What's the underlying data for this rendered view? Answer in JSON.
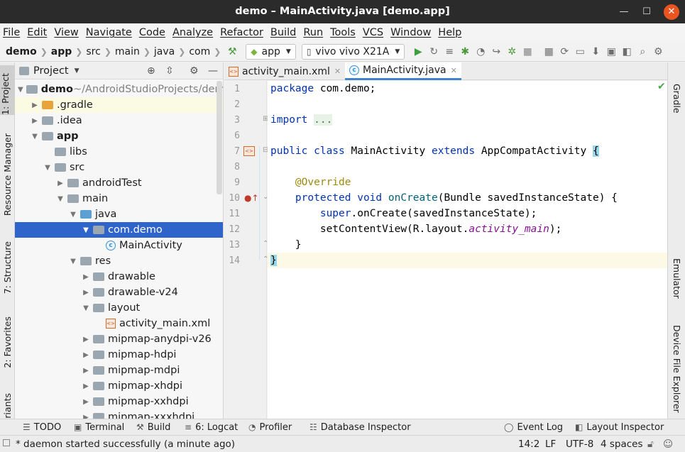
{
  "window": {
    "title": "demo – MainActivity.java [demo.app]"
  },
  "menu": [
    "File",
    "Edit",
    "View",
    "Navigate",
    "Code",
    "Analyze",
    "Refactor",
    "Build",
    "Run",
    "Tools",
    "VCS",
    "Window",
    "Help"
  ],
  "toolbar": {
    "breadcrumbs": [
      "demo",
      "app",
      "src",
      "main",
      "java",
      "com"
    ],
    "run_config": "app",
    "device": "vivo vivo X21A"
  },
  "left_strip": [
    "1: Project",
    "Resource Manager",
    "7: Structure",
    "2: Favorites",
    "riants"
  ],
  "right_strip": [
    "Gradle",
    "Emulator",
    "Device File Explorer"
  ],
  "project_panel": {
    "title": "Project",
    "tree": [
      {
        "label": "demo",
        "suffix": " ~/AndroidStudioProjects/dem",
        "depth": 0,
        "arrow": "down",
        "icon": "folder-module"
      },
      {
        "label": ".gradle",
        "depth": 1,
        "arrow": "right",
        "icon": "folder-orange"
      },
      {
        "label": ".idea",
        "depth": 1,
        "arrow": "right",
        "icon": "folder"
      },
      {
        "label": "app",
        "depth": 1,
        "arrow": "down",
        "icon": "folder-module"
      },
      {
        "label": "libs",
        "depth": 2,
        "arrow": "",
        "icon": "folder"
      },
      {
        "label": "src",
        "depth": 2,
        "arrow": "down",
        "icon": "folder"
      },
      {
        "label": "androidTest",
        "depth": 3,
        "arrow": "right",
        "icon": "folder"
      },
      {
        "label": "main",
        "depth": 3,
        "arrow": "down",
        "icon": "folder"
      },
      {
        "label": "java",
        "depth": 4,
        "arrow": "down",
        "icon": "folder-blue"
      },
      {
        "label": "com.demo",
        "depth": 5,
        "arrow": "down",
        "icon": "folder"
      },
      {
        "label": "MainActivity",
        "depth": 6,
        "arrow": "",
        "icon": "class"
      },
      {
        "label": "res",
        "depth": 4,
        "arrow": "down",
        "icon": "folder"
      },
      {
        "label": "drawable",
        "depth": 5,
        "arrow": "right",
        "icon": "folder"
      },
      {
        "label": "drawable-v24",
        "depth": 5,
        "arrow": "right",
        "icon": "folder"
      },
      {
        "label": "layout",
        "depth": 5,
        "arrow": "down",
        "icon": "folder"
      },
      {
        "label": "activity_main.xml",
        "depth": 6,
        "arrow": "",
        "icon": "xml"
      },
      {
        "label": "mipmap-anydpi-v26",
        "depth": 5,
        "arrow": "right",
        "icon": "folder"
      },
      {
        "label": "mipmap-hdpi",
        "depth": 5,
        "arrow": "right",
        "icon": "folder"
      },
      {
        "label": "mipmap-mdpi",
        "depth": 5,
        "arrow": "right",
        "icon": "folder"
      },
      {
        "label": "mipmap-xhdpi",
        "depth": 5,
        "arrow": "right",
        "icon": "folder"
      },
      {
        "label": "mipmap-xxhdpi",
        "depth": 5,
        "arrow": "right",
        "icon": "folder"
      },
      {
        "label": "mipmap-xxxhdpi",
        "depth": 5,
        "arrow": "right",
        "icon": "folder"
      }
    ],
    "selected_item": "com.demo"
  },
  "editor": {
    "tabs": [
      {
        "label": "activity_main.xml",
        "active": false
      },
      {
        "label": "MainActivity.java",
        "active": true
      }
    ],
    "line_numbers": [
      "1",
      "2",
      "3",
      "6",
      "7",
      "8",
      "9",
      "10",
      "11",
      "12",
      "13",
      "14"
    ]
  },
  "bottom_tools": [
    "TODO",
    "Terminal",
    "Build",
    "6: Logcat",
    "Profiler",
    "Database Inspector",
    "Event Log",
    "Layout Inspector"
  ],
  "status": {
    "message": "* daemon started successfully (a minute ago)",
    "position": "14:2",
    "line_sep": "LF",
    "encoding": "UTF-8",
    "indent": "4 spaces"
  }
}
